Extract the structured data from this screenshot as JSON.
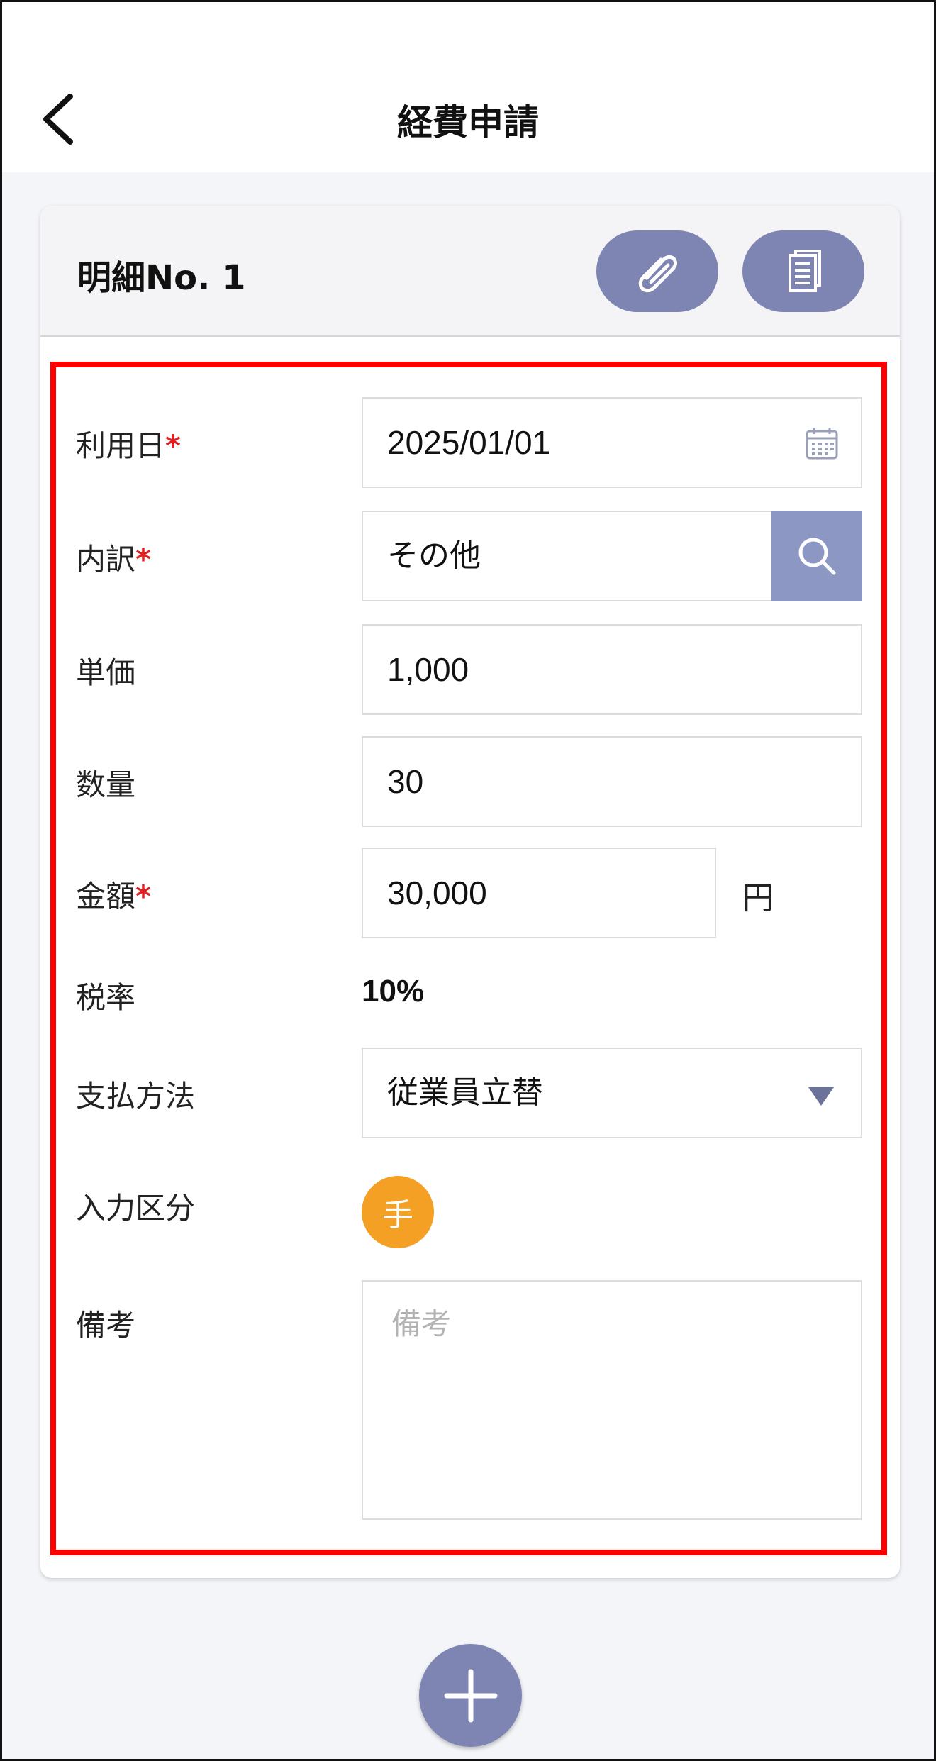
{
  "header": {
    "title": "経費申請"
  },
  "detail": {
    "title": "明細No. 1"
  },
  "colors": {
    "accent": "#7f85b3",
    "search": "#8c97c3",
    "required": "#e02020",
    "badge": "#f3a025",
    "highlight": "#ff0000"
  },
  "icons": {
    "back": "chevron-left-icon",
    "attach": "paperclip-icon",
    "copy": "document-icon",
    "calendar": "calendar-icon",
    "search": "search-icon",
    "dropdown": "triangle-down-icon",
    "add": "plus-icon"
  },
  "form": {
    "required_mark": "*",
    "date": {
      "label": "利用日",
      "value": "2025/01/01"
    },
    "category": {
      "label": "内訳",
      "value": "その他"
    },
    "unit_price": {
      "label": "単価",
      "value": "1,000"
    },
    "quantity": {
      "label": "数量",
      "value": "30"
    },
    "amount": {
      "label": "金額",
      "value": "30,000",
      "unit": "円"
    },
    "tax_rate": {
      "label": "税率",
      "value": "10%"
    },
    "payment": {
      "label": "支払方法",
      "value": "従業員立替"
    },
    "input_type": {
      "label": "入力区分",
      "value": "手"
    },
    "memo": {
      "label": "備考",
      "placeholder": "備考"
    }
  }
}
